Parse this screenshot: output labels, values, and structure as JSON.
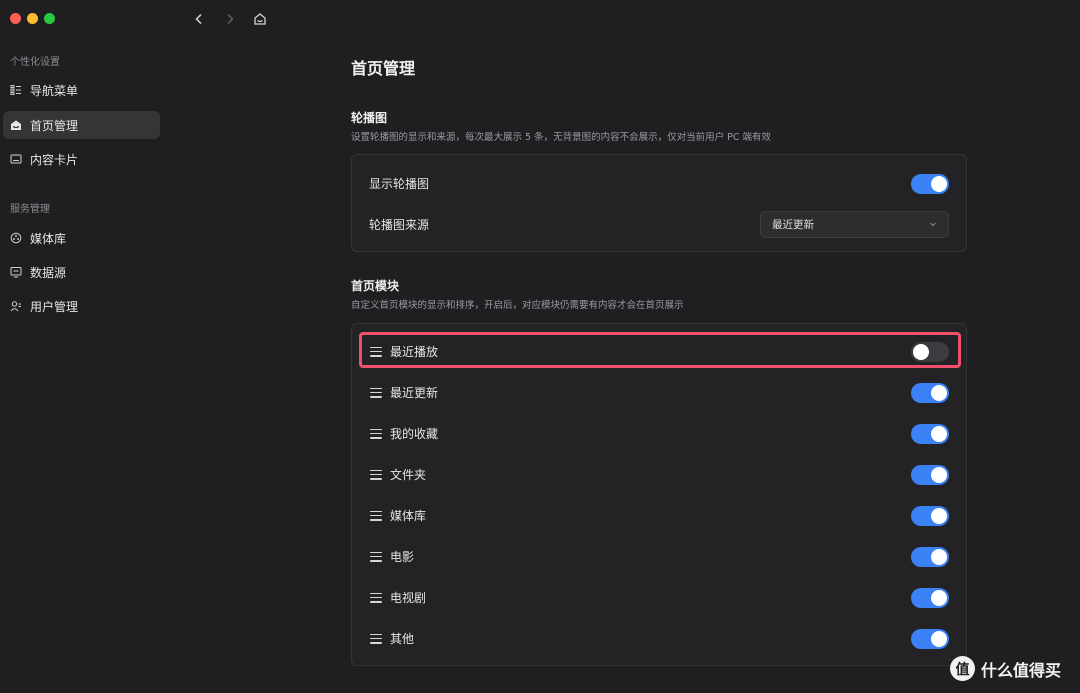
{
  "sidebar": {
    "section1": "个性化设置",
    "items1": [
      {
        "label": "导航菜单",
        "icon": "nav-menu-icon"
      },
      {
        "label": "首页管理",
        "icon": "home-icon",
        "active": true
      },
      {
        "label": "内容卡片",
        "icon": "card-icon"
      }
    ],
    "section2": "服务管理",
    "items2": [
      {
        "label": "媒体库",
        "icon": "media-library-icon"
      },
      {
        "label": "数据源",
        "icon": "data-source-icon"
      },
      {
        "label": "用户管理",
        "icon": "users-icon"
      }
    ]
  },
  "page": {
    "title": "首页管理"
  },
  "carousel": {
    "title": "轮播图",
    "desc": "设置轮播图的显示和来源，每次最大展示 5 条，无背景图的内容不会展示，仅对当前用户 PC 端有效",
    "show_label": "显示轮播图",
    "show_on": true,
    "source_label": "轮播图来源",
    "source_value": "最近更新"
  },
  "modules": {
    "title": "首页模块",
    "desc": "自定义首页模块的显示和排序，开启后，对应模块仍需要有内容才会在首页展示",
    "items": [
      {
        "label": "最近播放",
        "on": false
      },
      {
        "label": "最近更新",
        "on": true
      },
      {
        "label": "我的收藏",
        "on": true
      },
      {
        "label": "文件夹",
        "on": true
      },
      {
        "label": "媒体库",
        "on": true
      },
      {
        "label": "电影",
        "on": true
      },
      {
        "label": "电视剧",
        "on": true
      },
      {
        "label": "其他",
        "on": true
      }
    ]
  },
  "watermark": {
    "logo": "值",
    "text": "什么值得买"
  },
  "colors": {
    "accent": "#3b82f6",
    "highlight": "#f0506e",
    "background": "#1f1f21"
  }
}
